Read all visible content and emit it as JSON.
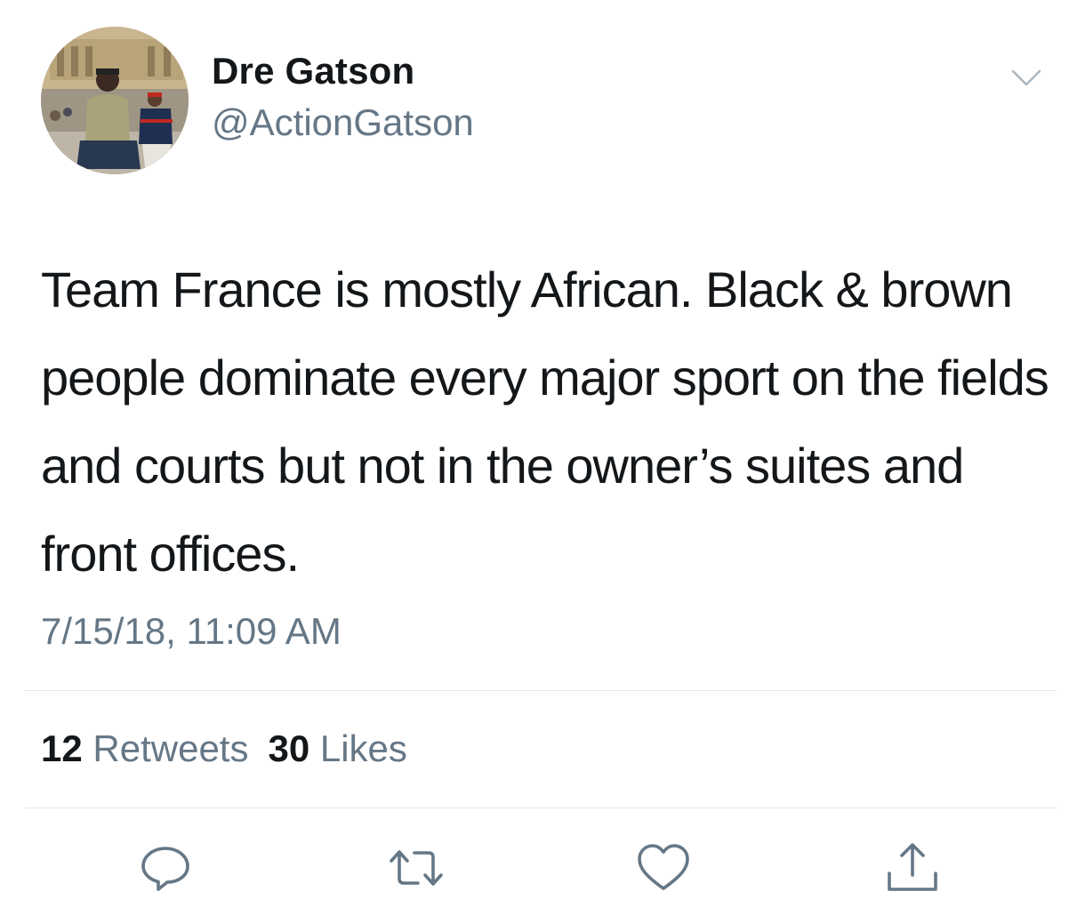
{
  "author": {
    "display_name": "Dre Gatson",
    "handle": "@ActionGatson"
  },
  "tweet": {
    "text": "Team France is mostly African. Black & brown people dominate every major sport on the fields and courts but not in the owner’s suites and front offices.",
    "timestamp": "7/15/18, 11:09 AM"
  },
  "stats": {
    "retweets_count": "12",
    "retweets_label": "Retweets",
    "likes_count": "30",
    "likes_label": "Likes"
  },
  "icons": {
    "menu": "chevron-down-icon",
    "reply": "reply-icon",
    "retweet": "retweet-icon",
    "like": "heart-icon",
    "share": "share-icon"
  },
  "colors": {
    "text": "#14171a",
    "secondary_text": "#657786",
    "divider": "#e1e8ed",
    "icon": "#657786"
  }
}
